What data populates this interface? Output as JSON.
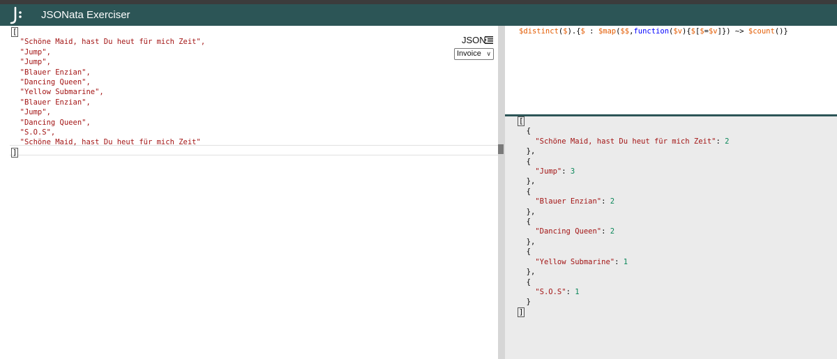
{
  "window": {
    "app_title": "JSONata Exerciser"
  },
  "input_panel": {
    "format_label": "JSON",
    "sample_select": {
      "selected": "Invoice"
    },
    "open_bracket": "[",
    "close_bracket": "]",
    "items": [
      "\"Schöne Maid, hast Du heut für mich Zeit\",",
      "\"Jump\",",
      "\"Jump\",",
      "\"Blauer Enzian\",",
      "\"Dancing Queen\",",
      "\"Yellow Submarine\",",
      "\"Blauer Enzian\",",
      "\"Jump\",",
      "\"Dancing Queen\",",
      "\"S.O.S\",",
      "\"Schöne Maid, hast Du heut für mich Zeit\""
    ]
  },
  "expression_panel": {
    "tokens": [
      {
        "t": "$distinct",
        "c": "var"
      },
      {
        "t": "(",
        "c": "pun"
      },
      {
        "t": "$",
        "c": "var"
      },
      {
        "t": ").{",
        "c": "pun"
      },
      {
        "t": "$",
        "c": "var"
      },
      {
        "t": " : ",
        "c": "pun"
      },
      {
        "t": "$map",
        "c": "var"
      },
      {
        "t": "(",
        "c": "pun"
      },
      {
        "t": "$$",
        "c": "var"
      },
      {
        "t": ",",
        "c": "pun"
      },
      {
        "t": "function",
        "c": "kw"
      },
      {
        "t": "(",
        "c": "pun"
      },
      {
        "t": "$v",
        "c": "var"
      },
      {
        "t": "){",
        "c": "pun"
      },
      {
        "t": "$",
        "c": "var"
      },
      {
        "t": "[",
        "c": "pun"
      },
      {
        "t": "$",
        "c": "var"
      },
      {
        "t": "=",
        "c": "pun"
      },
      {
        "t": "$v",
        "c": "var"
      },
      {
        "t": "]}) ~> ",
        "c": "pun"
      },
      {
        "t": "$count",
        "c": "var"
      },
      {
        "t": "()}",
        "c": "pun"
      }
    ]
  },
  "result_panel": {
    "open_bracket": "[",
    "close_bracket": "]",
    "entries": [
      {
        "key": "\"Schöne Maid, hast Du heut für mich Zeit\"",
        "value": "2"
      },
      {
        "key": "\"Jump\"",
        "value": "3"
      },
      {
        "key": "\"Blauer Enzian\"",
        "value": "2"
      },
      {
        "key": "\"Dancing Queen\"",
        "value": "2"
      },
      {
        "key": "\"Yellow Submarine\"",
        "value": "1"
      },
      {
        "key": "\"S.O.S\"",
        "value": "1"
      }
    ]
  },
  "colors": {
    "banner": "#2c5556",
    "string": "#a31515",
    "number": "#098658",
    "variable": "#e35a00",
    "keyword": "#0000ff"
  }
}
